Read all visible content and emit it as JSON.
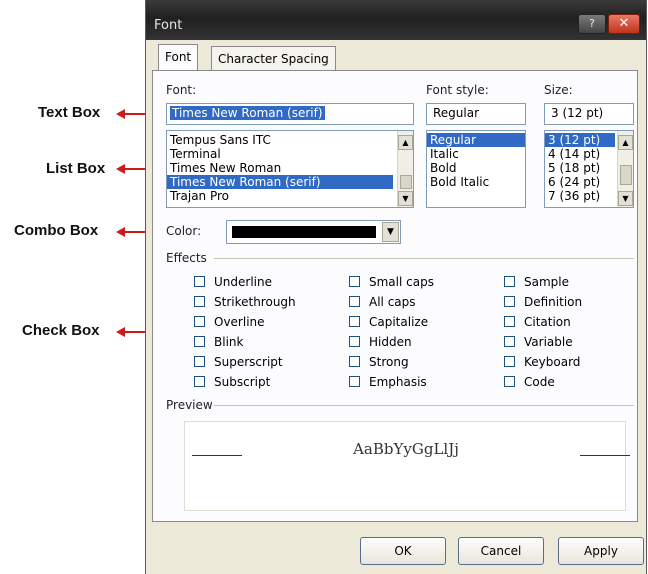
{
  "annotations": {
    "text_box": "Text Box",
    "list_box": "List Box",
    "combo_box": "Combo Box",
    "check_box": "Check Box",
    "arrow_color": "#cc1b1b"
  },
  "dialog": {
    "title": "Font",
    "tabs": [
      {
        "label": "Font",
        "active": true
      },
      {
        "label": "Character Spacing",
        "active": false
      }
    ],
    "font": {
      "label": "Font:",
      "value": "Times New Roman (serif)",
      "list": [
        "Tempus Sans ITC",
        "Terminal",
        "Times New Roman",
        "Times New Roman (serif)",
        "Trajan Pro"
      ],
      "selected_index": 3
    },
    "font_style": {
      "label": "Font style:",
      "value": "Regular",
      "list": [
        "Regular",
        "Italic",
        "Bold",
        "Bold Italic"
      ],
      "selected_index": 0
    },
    "size": {
      "label": "Size:",
      "value": "3  (12 pt)",
      "list": [
        "3  (12 pt)",
        "4  (14 pt)",
        "5  (18 pt)",
        "6  (24 pt)",
        "7  (36 pt)"
      ],
      "selected_index": 0
    },
    "color": {
      "label": "Color:",
      "value": "#000000"
    },
    "effects": {
      "label": "Effects",
      "column1": [
        "Underline",
        "Strikethrough",
        "Overline",
        "Blink",
        "Superscript",
        "Subscript"
      ],
      "column2": [
        "Small caps",
        "All caps",
        "Capitalize",
        "Hidden",
        "Strong",
        "Emphasis"
      ],
      "column3": [
        "Sample",
        "Definition",
        "Citation",
        "Variable",
        "Keyboard",
        "Code"
      ]
    },
    "preview": {
      "label": "Preview",
      "sample_text": "AaBbYyGgLlJj"
    },
    "buttons": {
      "ok": "OK",
      "cancel": "Cancel",
      "apply": "Apply"
    }
  }
}
